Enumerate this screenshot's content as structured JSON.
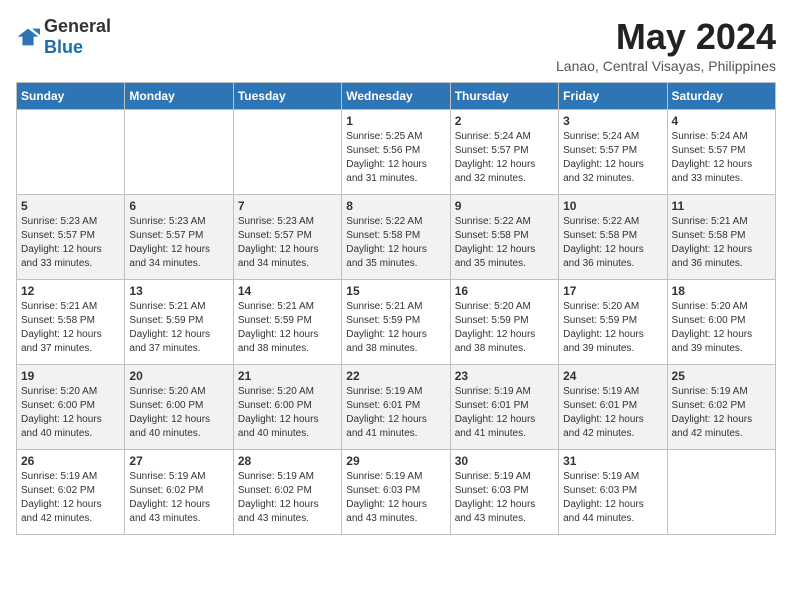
{
  "logo": {
    "text_general": "General",
    "text_blue": "Blue"
  },
  "title": "May 2024",
  "location": "Lanao, Central Visayas, Philippines",
  "days_of_week": [
    "Sunday",
    "Monday",
    "Tuesday",
    "Wednesday",
    "Thursday",
    "Friday",
    "Saturday"
  ],
  "weeks": [
    [
      {
        "day": "",
        "info": ""
      },
      {
        "day": "",
        "info": ""
      },
      {
        "day": "",
        "info": ""
      },
      {
        "day": "1",
        "info": "Sunrise: 5:25 AM\nSunset: 5:56 PM\nDaylight: 12 hours\nand 31 minutes."
      },
      {
        "day": "2",
        "info": "Sunrise: 5:24 AM\nSunset: 5:57 PM\nDaylight: 12 hours\nand 32 minutes."
      },
      {
        "day": "3",
        "info": "Sunrise: 5:24 AM\nSunset: 5:57 PM\nDaylight: 12 hours\nand 32 minutes."
      },
      {
        "day": "4",
        "info": "Sunrise: 5:24 AM\nSunset: 5:57 PM\nDaylight: 12 hours\nand 33 minutes."
      }
    ],
    [
      {
        "day": "5",
        "info": "Sunrise: 5:23 AM\nSunset: 5:57 PM\nDaylight: 12 hours\nand 33 minutes."
      },
      {
        "day": "6",
        "info": "Sunrise: 5:23 AM\nSunset: 5:57 PM\nDaylight: 12 hours\nand 34 minutes."
      },
      {
        "day": "7",
        "info": "Sunrise: 5:23 AM\nSunset: 5:57 PM\nDaylight: 12 hours\nand 34 minutes."
      },
      {
        "day": "8",
        "info": "Sunrise: 5:22 AM\nSunset: 5:58 PM\nDaylight: 12 hours\nand 35 minutes."
      },
      {
        "day": "9",
        "info": "Sunrise: 5:22 AM\nSunset: 5:58 PM\nDaylight: 12 hours\nand 35 minutes."
      },
      {
        "day": "10",
        "info": "Sunrise: 5:22 AM\nSunset: 5:58 PM\nDaylight: 12 hours\nand 36 minutes."
      },
      {
        "day": "11",
        "info": "Sunrise: 5:21 AM\nSunset: 5:58 PM\nDaylight: 12 hours\nand 36 minutes."
      }
    ],
    [
      {
        "day": "12",
        "info": "Sunrise: 5:21 AM\nSunset: 5:58 PM\nDaylight: 12 hours\nand 37 minutes."
      },
      {
        "day": "13",
        "info": "Sunrise: 5:21 AM\nSunset: 5:59 PM\nDaylight: 12 hours\nand 37 minutes."
      },
      {
        "day": "14",
        "info": "Sunrise: 5:21 AM\nSunset: 5:59 PM\nDaylight: 12 hours\nand 38 minutes."
      },
      {
        "day": "15",
        "info": "Sunrise: 5:21 AM\nSunset: 5:59 PM\nDaylight: 12 hours\nand 38 minutes."
      },
      {
        "day": "16",
        "info": "Sunrise: 5:20 AM\nSunset: 5:59 PM\nDaylight: 12 hours\nand 38 minutes."
      },
      {
        "day": "17",
        "info": "Sunrise: 5:20 AM\nSunset: 5:59 PM\nDaylight: 12 hours\nand 39 minutes."
      },
      {
        "day": "18",
        "info": "Sunrise: 5:20 AM\nSunset: 6:00 PM\nDaylight: 12 hours\nand 39 minutes."
      }
    ],
    [
      {
        "day": "19",
        "info": "Sunrise: 5:20 AM\nSunset: 6:00 PM\nDaylight: 12 hours\nand 40 minutes."
      },
      {
        "day": "20",
        "info": "Sunrise: 5:20 AM\nSunset: 6:00 PM\nDaylight: 12 hours\nand 40 minutes."
      },
      {
        "day": "21",
        "info": "Sunrise: 5:20 AM\nSunset: 6:00 PM\nDaylight: 12 hours\nand 40 minutes."
      },
      {
        "day": "22",
        "info": "Sunrise: 5:19 AM\nSunset: 6:01 PM\nDaylight: 12 hours\nand 41 minutes."
      },
      {
        "day": "23",
        "info": "Sunrise: 5:19 AM\nSunset: 6:01 PM\nDaylight: 12 hours\nand 41 minutes."
      },
      {
        "day": "24",
        "info": "Sunrise: 5:19 AM\nSunset: 6:01 PM\nDaylight: 12 hours\nand 42 minutes."
      },
      {
        "day": "25",
        "info": "Sunrise: 5:19 AM\nSunset: 6:02 PM\nDaylight: 12 hours\nand 42 minutes."
      }
    ],
    [
      {
        "day": "26",
        "info": "Sunrise: 5:19 AM\nSunset: 6:02 PM\nDaylight: 12 hours\nand 42 minutes."
      },
      {
        "day": "27",
        "info": "Sunrise: 5:19 AM\nSunset: 6:02 PM\nDaylight: 12 hours\nand 43 minutes."
      },
      {
        "day": "28",
        "info": "Sunrise: 5:19 AM\nSunset: 6:02 PM\nDaylight: 12 hours\nand 43 minutes."
      },
      {
        "day": "29",
        "info": "Sunrise: 5:19 AM\nSunset: 6:03 PM\nDaylight: 12 hours\nand 43 minutes."
      },
      {
        "day": "30",
        "info": "Sunrise: 5:19 AM\nSunset: 6:03 PM\nDaylight: 12 hours\nand 43 minutes."
      },
      {
        "day": "31",
        "info": "Sunrise: 5:19 AM\nSunset: 6:03 PM\nDaylight: 12 hours\nand 44 minutes."
      },
      {
        "day": "",
        "info": ""
      }
    ]
  ]
}
